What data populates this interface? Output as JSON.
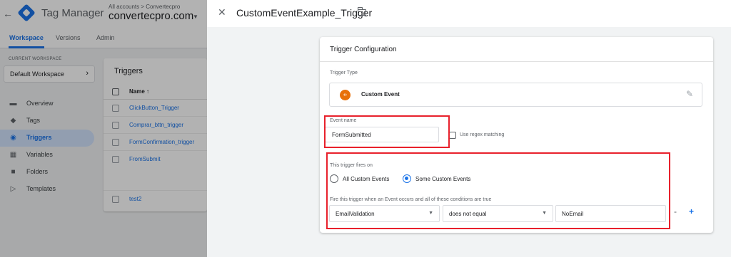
{
  "app": {
    "product_name": "Tag Manager",
    "account_path": "All accounts > Convertecpro",
    "container_name": "convertecpro.com"
  },
  "tabs": [
    {
      "label": "Workspace",
      "active": true
    },
    {
      "label": "Versions",
      "active": false
    },
    {
      "label": "Admin",
      "active": false
    }
  ],
  "workspace": {
    "section_label": "CURRENT WORKSPACE",
    "name": "Default Workspace"
  },
  "nav": [
    {
      "label": "Overview",
      "icon": "briefcase-icon",
      "active": false
    },
    {
      "label": "Tags",
      "icon": "tag-icon",
      "active": false
    },
    {
      "label": "Triggers",
      "icon": "trigger-icon",
      "active": true
    },
    {
      "label": "Variables",
      "icon": "variables-icon",
      "active": false
    },
    {
      "label": "Folders",
      "icon": "folder-icon",
      "active": false
    },
    {
      "label": "Templates",
      "icon": "template-icon",
      "active": false
    }
  ],
  "triggers_list": {
    "title": "Triggers",
    "column_name": "Name ↑",
    "rows": [
      "ClickButton_Trigger",
      "Comprar_bttn_trigger",
      "FormConfirmation_trigger",
      "FromSubmit",
      "test2"
    ]
  },
  "panel": {
    "title": "CustomEventExample_Trigger",
    "config_title": "Trigger Configuration",
    "trigger_type_label": "Trigger Type",
    "trigger_type_name": "Custom Event",
    "event_name_label": "Event name",
    "event_name_value": "FormSubmitted",
    "regex_label": "Use regex matching",
    "fires_on_label": "This trigger fires on",
    "radio_all": "All Custom Events",
    "radio_some": "Some Custom Events",
    "selected_option": "Some Custom Events",
    "conditions_label": "Fire this trigger when an Event occurs and all of these conditions are true",
    "condition": {
      "variable": "EmailValidation",
      "operator": "does not equal",
      "value": "NoEmail"
    },
    "remove_label": "-",
    "add_label": "+"
  },
  "colors": {
    "accent": "#1a73e8",
    "highlight_box": "#e8212c",
    "custom_event_icon": "#e8710a"
  }
}
